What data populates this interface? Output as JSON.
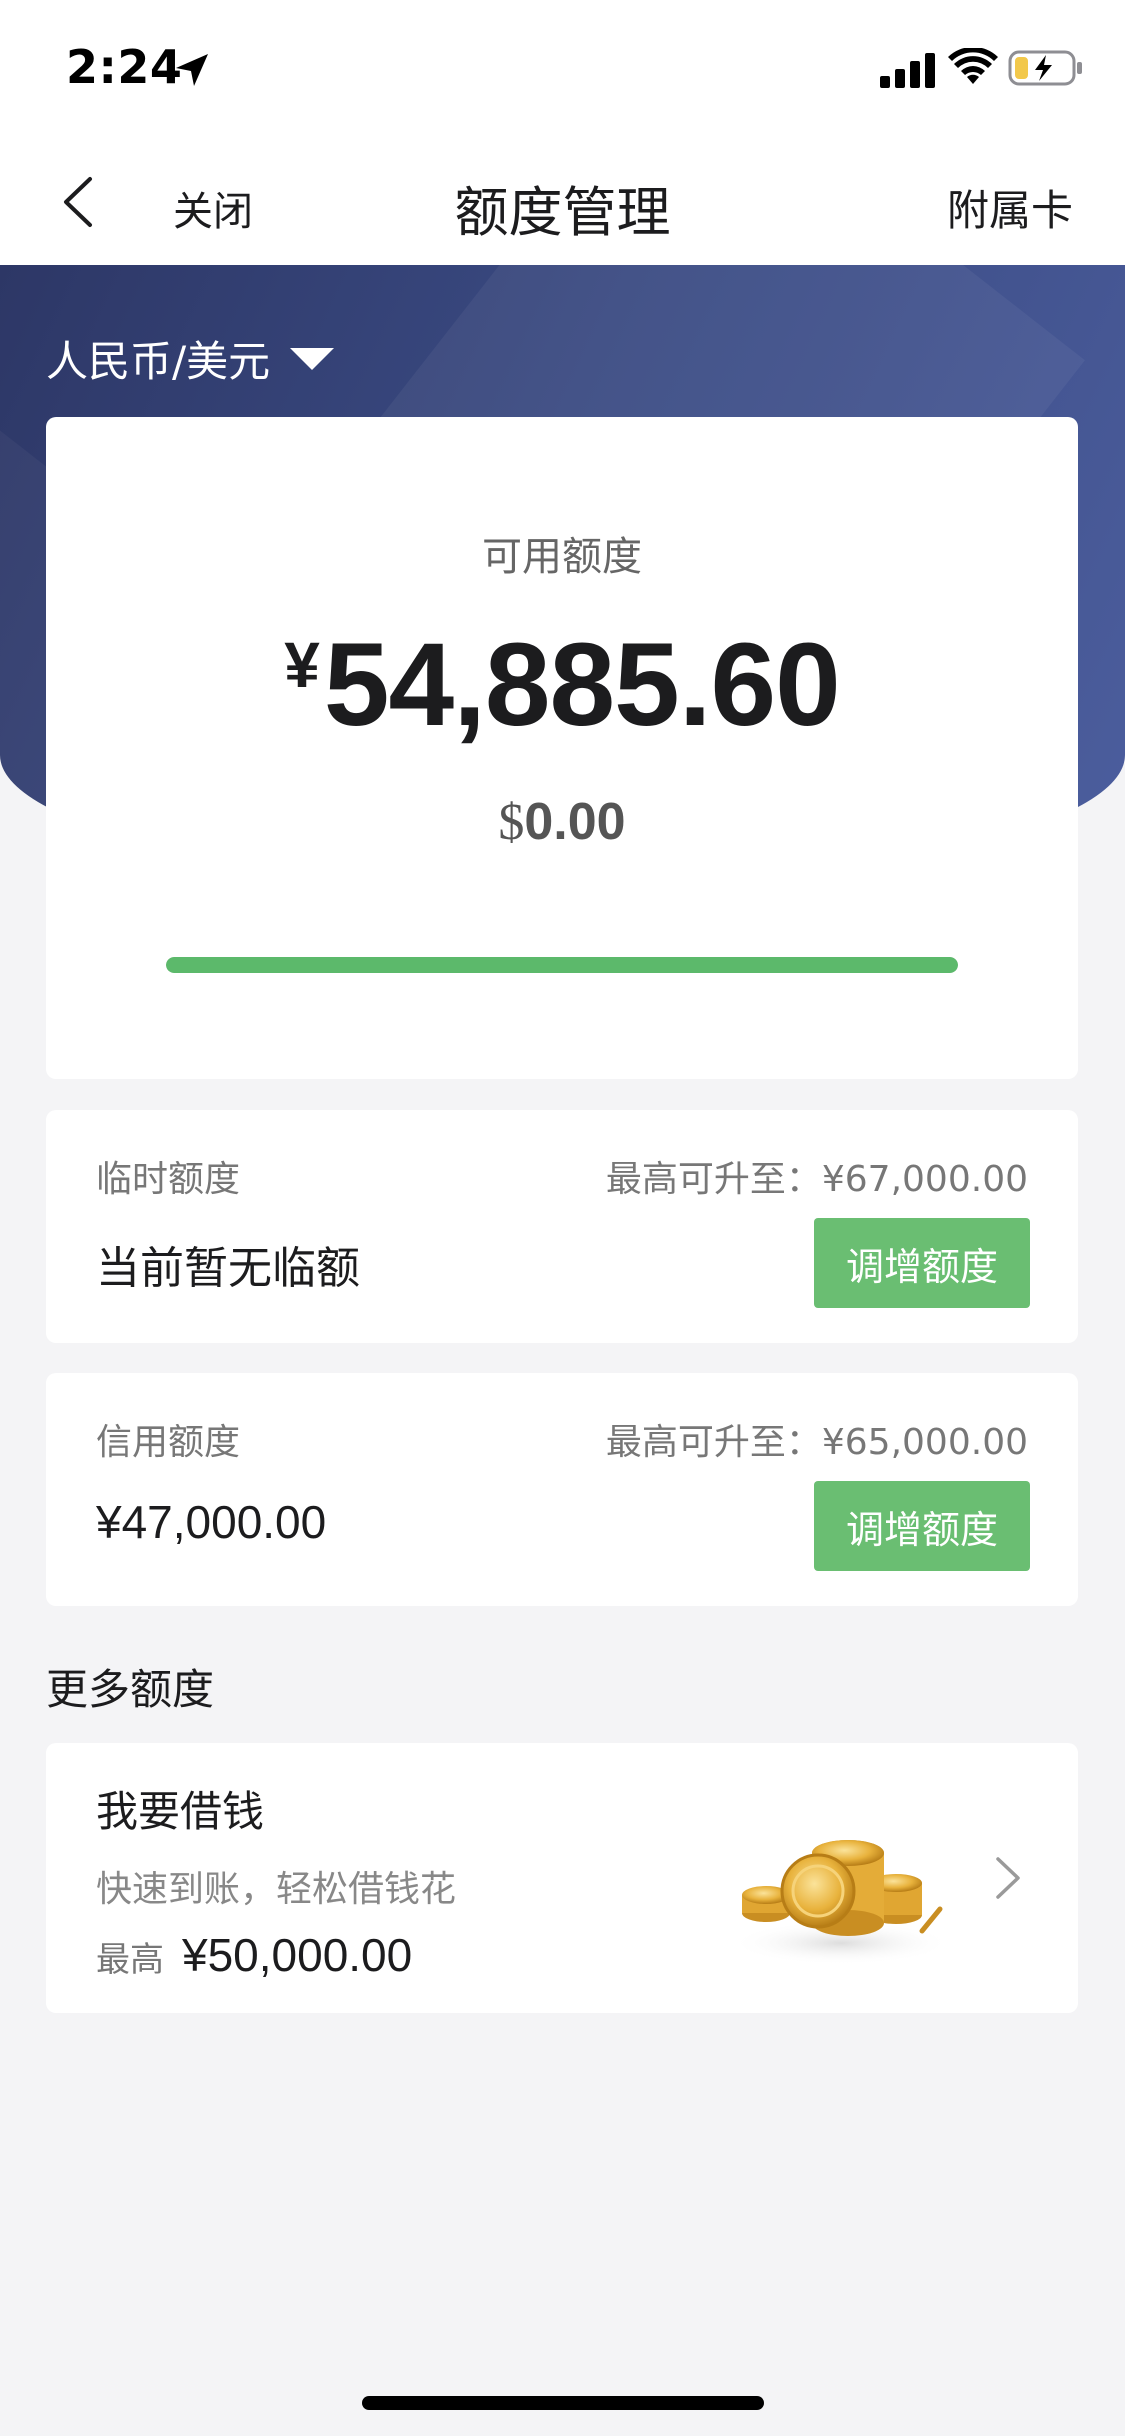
{
  "status_bar": {
    "time": "2:24",
    "icons": [
      "location-arrow-icon",
      "signal-icon",
      "wifi-icon",
      "battery-charging-icon"
    ]
  },
  "nav": {
    "back_icon": "chevron-left-icon",
    "close_label": "关闭",
    "title": "额度管理",
    "right_label": "附属卡"
  },
  "hero": {
    "currency_selector": "人民币/美元",
    "dropdown_icon": "caret-down-icon"
  },
  "available": {
    "label": "可用额度",
    "cny_symbol": "¥",
    "cny_amount": "54,885.60",
    "usd_symbol": "$",
    "usd_amount": "0.00",
    "progress_fraction": 1.0
  },
  "temporary_limit": {
    "label": "临时额度",
    "max_text": "最高可升至：¥67,000.00",
    "value": "当前暂无临额",
    "button": "调增额度"
  },
  "credit_limit": {
    "label": "信用额度",
    "max_text": "最高可升至：¥65,000.00",
    "value": "¥47,000.00",
    "button": "调增额度"
  },
  "more": {
    "section_title": "更多额度",
    "loan": {
      "title": "我要借钱",
      "subtitle": "快速到账，轻松借钱花",
      "max_label": "最高",
      "max_value": "¥50,000.00",
      "image_icon": "gold-coins-icon"
    }
  },
  "colors": {
    "hero_gradient_start": "#2d3766",
    "hero_gradient_end": "#4c5e9e",
    "accent_green": "#6abe72",
    "progress_green": "#5cb96b",
    "background": "#f4f4f6"
  }
}
